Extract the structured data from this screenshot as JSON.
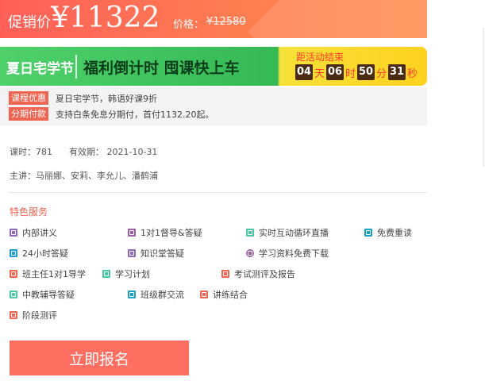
{
  "price": {
    "label": "促销价",
    "value": "¥11322",
    "original_label": "价格：",
    "original_value": "¥12580"
  },
  "promo": {
    "tag": "夏日宅学节",
    "slogan": "福利倒计时 囤课快上车",
    "countdown_title": "距活动结束",
    "days": "04",
    "days_unit": "天",
    "hours": "06",
    "hours_unit": "时",
    "minutes": "50",
    "minutes_unit": "分",
    "seconds": "31",
    "seconds_unit": "秒"
  },
  "discounts": [
    {
      "tag": "课程优惠",
      "text": "夏日宅学节，韩语好课9折"
    },
    {
      "tag": "分期付款",
      "text": "支持白条免息分期付，首付1132.20起。"
    }
  ],
  "course": {
    "hours": "课时：781",
    "validity": "有效期：  2021-10-31",
    "teachers": "主讲：马丽娜、安莉、李允儿、潘鹤浦"
  },
  "services_title": "特色服务",
  "services": [
    {
      "label": "内部讲义",
      "icon": "handout-icon",
      "color": "#8e6bbf"
    },
    {
      "label": "1对1督导&答疑",
      "icon": "mentor-icon",
      "color": "#9b5fa6"
    },
    {
      "label": "实时互动循环直播",
      "icon": "live-icon",
      "color": "#4cc7a6"
    },
    {
      "label": "免费重读",
      "icon": "star-icon",
      "color": "#1aa3c7"
    },
    {
      "label": "24小时答疑",
      "icon": "24h-icon",
      "color": "#1f9bd1"
    },
    {
      "label": "知识堂答疑",
      "icon": "knowledge-icon",
      "color": "#8e6bbf"
    },
    {
      "label": "学习资料免费下载",
      "icon": "download-icon",
      "color": "#9b5fa6"
    },
    {
      "label": "班主任1对1导学",
      "icon": "teacher-icon",
      "color": "#f06552"
    },
    {
      "label": "学习计划",
      "icon": "plan-icon",
      "color": "#4cc7a6"
    },
    {
      "label": "考试测评及报告",
      "icon": "report-icon",
      "color": "#f06552"
    },
    {
      "label": "中教辅导答疑",
      "icon": "tutor-icon",
      "color": "#4cc7a6"
    },
    {
      "label": "班级群交流",
      "icon": "group-chat-icon",
      "color": "#1aa3c7"
    },
    {
      "label": "讲练结合",
      "icon": "practice-icon",
      "color": "#f06552"
    },
    {
      "label": "阶段测评",
      "icon": "assessment-icon",
      "color": "#f06552"
    }
  ],
  "enroll_label": "立即报名"
}
